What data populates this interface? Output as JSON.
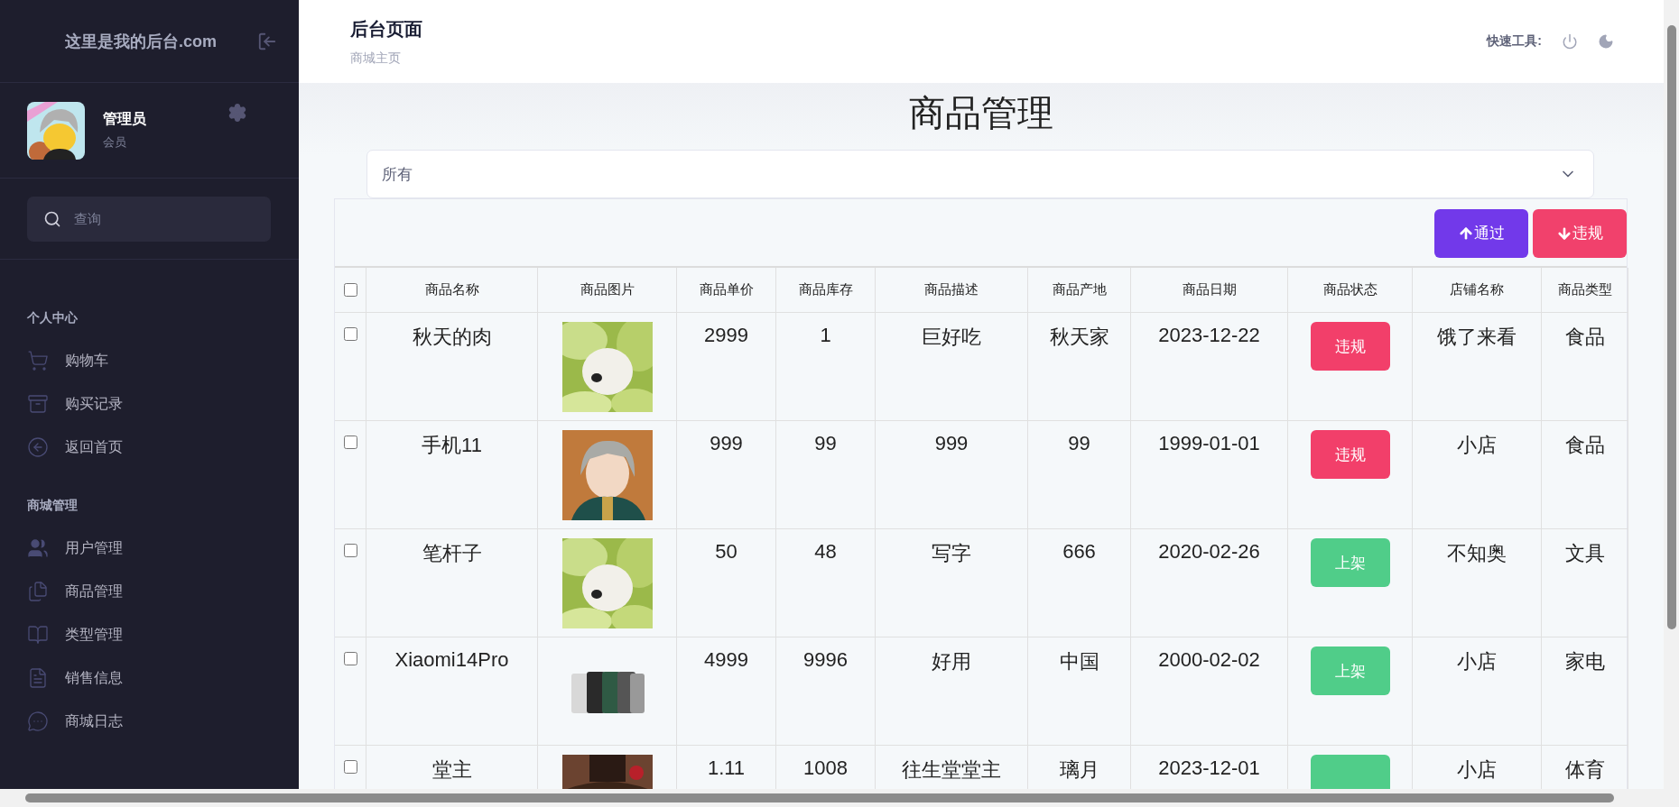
{
  "sidebar": {
    "brand": "这里是我的后台.com",
    "user": {
      "name": "管理员",
      "role": "会员"
    },
    "search": {
      "placeholder": "查询"
    },
    "sections": [
      {
        "title": "个人中心",
        "items": [
          "购物车",
          "购买记录",
          "返回首页"
        ]
      },
      {
        "title": "商城管理",
        "items": [
          "用户管理",
          "商品管理",
          "类型管理",
          "销售信息",
          "商城日志"
        ]
      }
    ]
  },
  "header": {
    "title": "后台页面",
    "breadcrumb": "商城主页",
    "tools_label": "快速工具:"
  },
  "page_title": "商品管理",
  "filter": {
    "value": "所有"
  },
  "actions": [
    {
      "kind": "approve",
      "label": "通过"
    },
    {
      "kind": "reject",
      "label": "违规"
    }
  ],
  "table": {
    "select_all": {
      "checked": false
    },
    "columns": [
      "商品名称",
      "商品图片",
      "商品单价",
      "商品库存",
      "商品描述",
      "商品产地",
      "商品日期",
      "商品状态",
      "店铺名称",
      "商品类型"
    ],
    "rows": [
      {
        "checked": false,
        "name": "秋天的肉",
        "price": "2999",
        "stock": "1",
        "description": "巨好吃",
        "origin": "秋天家",
        "date": "2023-12-22",
        "status": {
          "kind": "violation",
          "label": "违规"
        },
        "shop": "饿了来看",
        "type": "食品"
      },
      {
        "checked": false,
        "name": "手机11",
        "price": "999",
        "stock": "99",
        "description": "999",
        "origin": "99",
        "date": "1999-01-01",
        "status": {
          "kind": "violation",
          "label": "违规"
        },
        "shop": "小店",
        "type": "食品"
      },
      {
        "checked": false,
        "name": "笔杆子",
        "price": "50",
        "stock": "48",
        "description": "写字",
        "origin": "666",
        "date": "2020-02-26",
        "status": {
          "kind": "listed",
          "label": "上架"
        },
        "shop": "不知奥",
        "type": "文具"
      },
      {
        "checked": false,
        "name": "Xiaomi14Pro",
        "price": "4999",
        "stock": "9996",
        "description": "好用",
        "origin": "中国",
        "date": "2000-02-02",
        "status": {
          "kind": "listed",
          "label": "上架"
        },
        "shop": "小店",
        "type": "家电"
      },
      {
        "checked": false,
        "name": "堂主",
        "price": "1.11",
        "stock": "1008",
        "description": "往生堂堂主",
        "origin": "璃月",
        "date": "2023-12-01",
        "status": {
          "kind": "listed"
        },
        "shop": "小店",
        "type": "体育"
      }
    ]
  }
}
